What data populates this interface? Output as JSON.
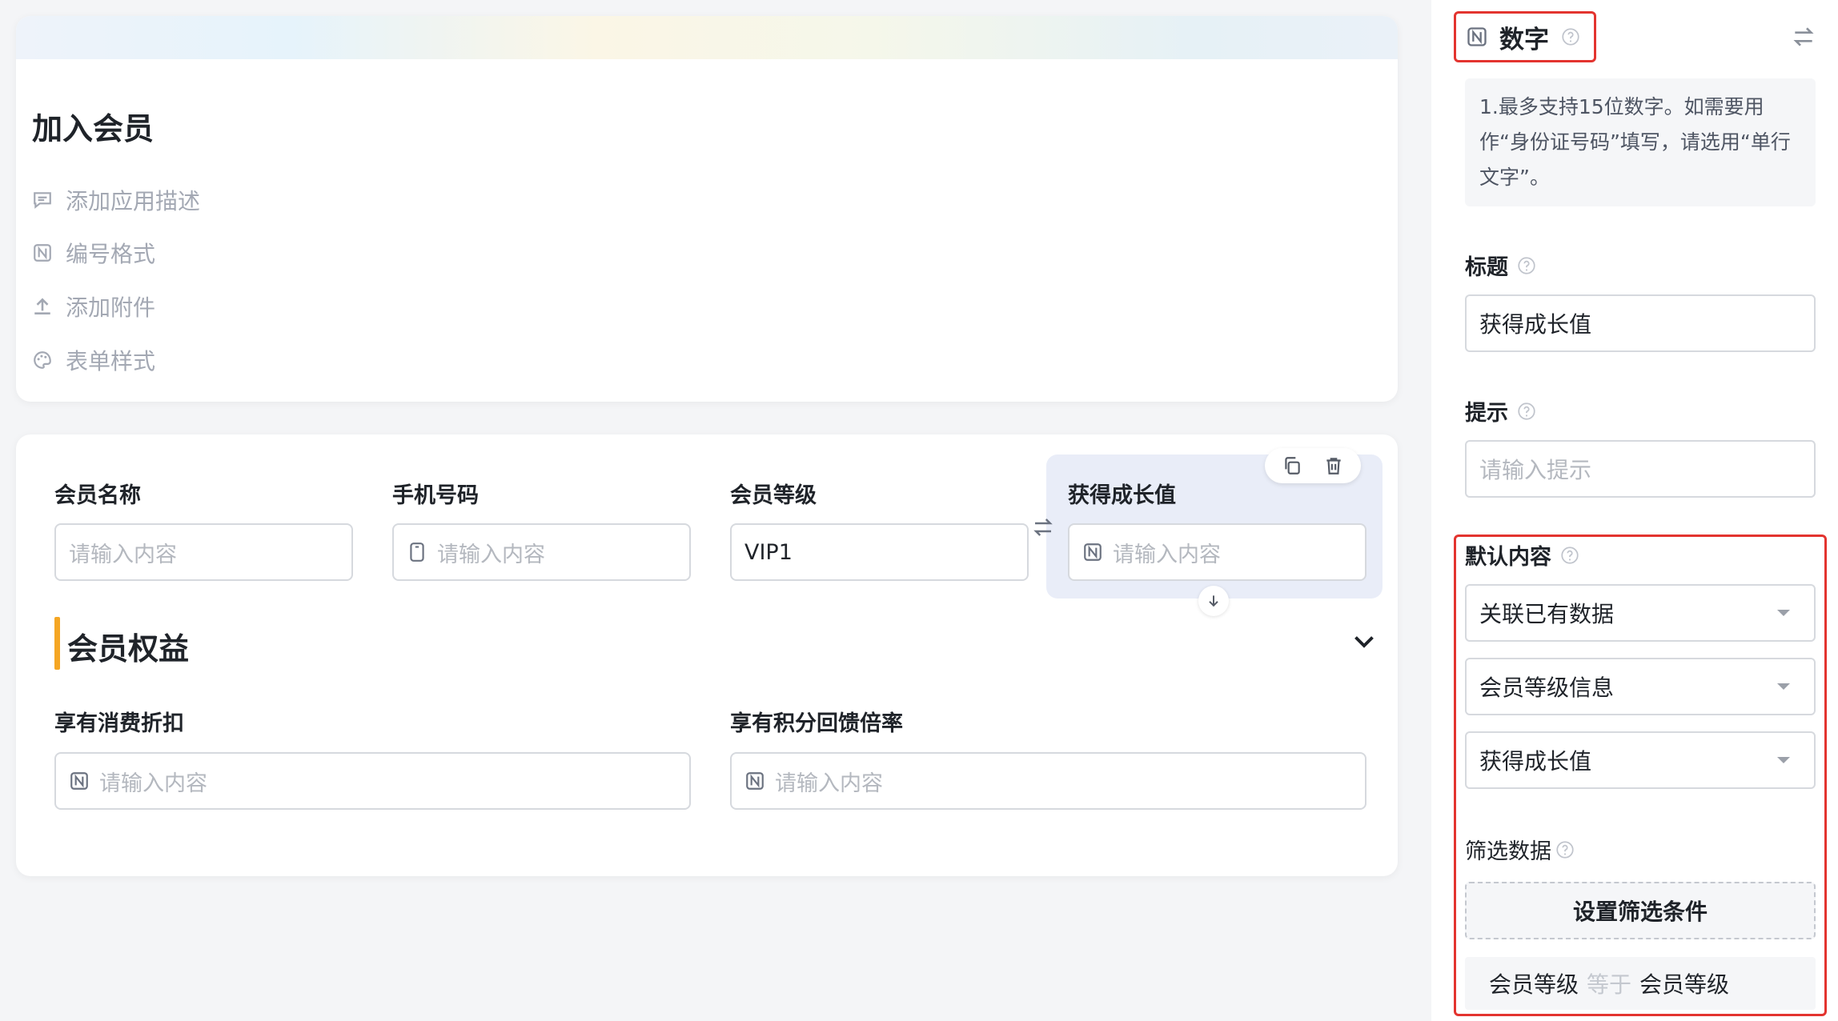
{
  "header": {
    "app_title": "加入会员",
    "options": [
      {
        "label": "添加应用描述",
        "icon": "comment-icon"
      },
      {
        "label": "编号格式",
        "icon": "number-format-icon"
      },
      {
        "label": "添加附件",
        "icon": "upload-icon"
      },
      {
        "label": "表单样式",
        "icon": "palette-icon"
      }
    ]
  },
  "form": {
    "fields": [
      {
        "label": "会员名称",
        "placeholder": "请输入内容",
        "icon": ""
      },
      {
        "label": "手机号码",
        "placeholder": "请输入内容",
        "icon": "phone-icon"
      },
      {
        "label": "会员等级",
        "value": "VIP1"
      },
      {
        "label": "获得成长值",
        "placeholder": "请输入内容",
        "icon": "number-icon",
        "selected": true
      }
    ],
    "section": {
      "title": "会员权益",
      "fields": [
        {
          "label": "享有消费折扣",
          "placeholder": "请输入内容",
          "icon": "number-icon"
        },
        {
          "label": "享有积分回馈倍率",
          "placeholder": "请输入内容",
          "icon": "number-icon"
        }
      ]
    }
  },
  "panel": {
    "type_label": "数字",
    "tip": "1.最多支持15位数字。如需要用作“身份证号码”填写，请选用“单行文字”。",
    "title_label": "标题",
    "title_value": "获得成长值",
    "hint_label": "提示",
    "hint_placeholder": "请输入提示",
    "default_label": "默认内容",
    "selects": [
      "关联已有数据",
      "会员等级信息",
      "获得成长值"
    ],
    "filter_label": "筛选数据",
    "filter_button": "设置筛选条件",
    "condition": {
      "field": "会员等级",
      "operator": "等于",
      "value": "会员等级"
    }
  },
  "colors": {
    "accent_orange": "#f5a623",
    "highlight_red": "#e3342f",
    "selected_bg": "#e9edf8"
  }
}
